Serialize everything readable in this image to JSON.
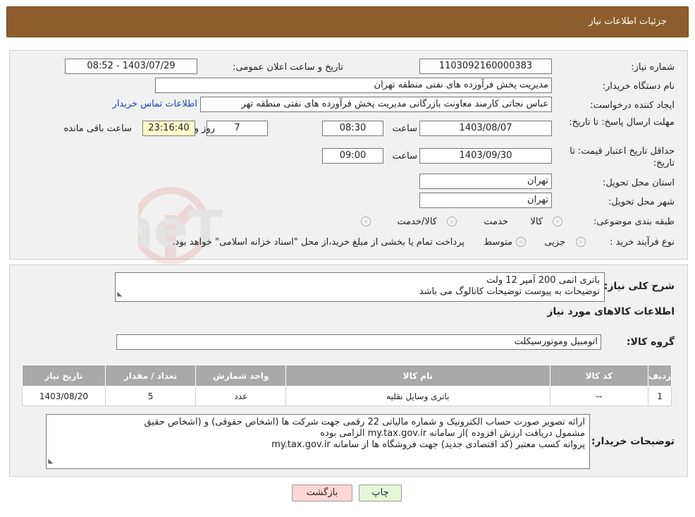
{
  "header": {
    "title": "جزئیات اطلاعات نیاز"
  },
  "form": {
    "need_number": {
      "label": "شماره نیاز:",
      "value": "1103092160000383"
    },
    "announce_date": {
      "label": "تاریخ و ساعت اعلان عمومی:",
      "value": "1403/07/29 - 08:52"
    },
    "buyer_org": {
      "label": "نام دستگاه خریدار:",
      "value": "مدیریت پخش فرآورده های نفتی منطقه تهران"
    },
    "requester": {
      "label": "ایجاد کننده درخواست:",
      "value": "عباس نجاتی کارمند معاونت بازرگانی مدیریت پخش فرآورده های نفتی منطقه تهر",
      "contact_link": "اطلاعات تماس خریدار"
    },
    "reply_deadline": {
      "label": "مهلت ارسال پاسخ: تا تاریخ:",
      "date": "1403/08/07",
      "time_label": "ساعت",
      "time": "08:30",
      "days": "7",
      "days_label": "روز و",
      "remaining": "23:16:40",
      "remaining_label": "ساعت باقی مانده"
    },
    "price_validity": {
      "label": "حداقل تاریخ اعتبار قیمت: تا تاریخ:",
      "date": "1403/09/30",
      "time_label": "ساعت",
      "time": "09:00"
    },
    "province": {
      "label": "استان محل تحویل:",
      "value": "تهران"
    },
    "city": {
      "label": "شهر محل تحویل:",
      "value": "تهران"
    },
    "category": {
      "label": "طبقه بندی موضوعی:",
      "options": [
        "کالا",
        "خدمت",
        "کالا/خدمت"
      ]
    },
    "purchase_process": {
      "label": "نوع فرآیند خرید :",
      "options": [
        "جزیی",
        "متوسط"
      ],
      "note": "پرداخت تمام یا بخشی از مبلغ خرید،از محل \"اسناد خزانه اسلامی\" خواهد بود."
    }
  },
  "details": {
    "summary_label": "شرح کلی نیاز:",
    "summary_line1": "باتری اتمی 200 آمپر 12 ولت",
    "summary_line2": "توضیحات به پیوست توضیحات کاتالوگ می باشد",
    "goods_info_title": "اطلاعات کالاهای مورد نیاز",
    "goods_group_label": "گروه کالا:",
    "goods_group_value": "اتومبیل وموتورسیکلت",
    "table": {
      "headers": [
        "ردیف",
        "کد کالا",
        "نام کالا",
        "واحد شمارش",
        "تعداد / مقدار",
        "تاریخ نیاز"
      ],
      "rows": [
        [
          "1",
          "--",
          "باتری وسایل نقلیه",
          "عدد",
          "5",
          "1403/08/20"
        ]
      ]
    },
    "buyer_notes_label": "توضیحات خریدار:",
    "buyer_notes_line1": "ارائه  تصویر صورت حساب الکترونیک و شماره مالیاتی 22 رقمی  جهت شرکت ها (اشخاص حقوقی) و (اشخاص حقیق",
    "buyer_notes_line2": "مشمول دریافت ارزش افزوده )از سامانه my.tax.gov.ir  الزامی بوده",
    "buyer_notes_line3": "پروانه کسب معتبر (کد اقتصادی جدید) جهت فروشگاه ها از سامانه my.tax.gov.ir"
  },
  "buttons": {
    "back": "بازگشت",
    "print": "چاپ"
  },
  "watermark": {
    "text": "AriaTender.neT"
  }
}
